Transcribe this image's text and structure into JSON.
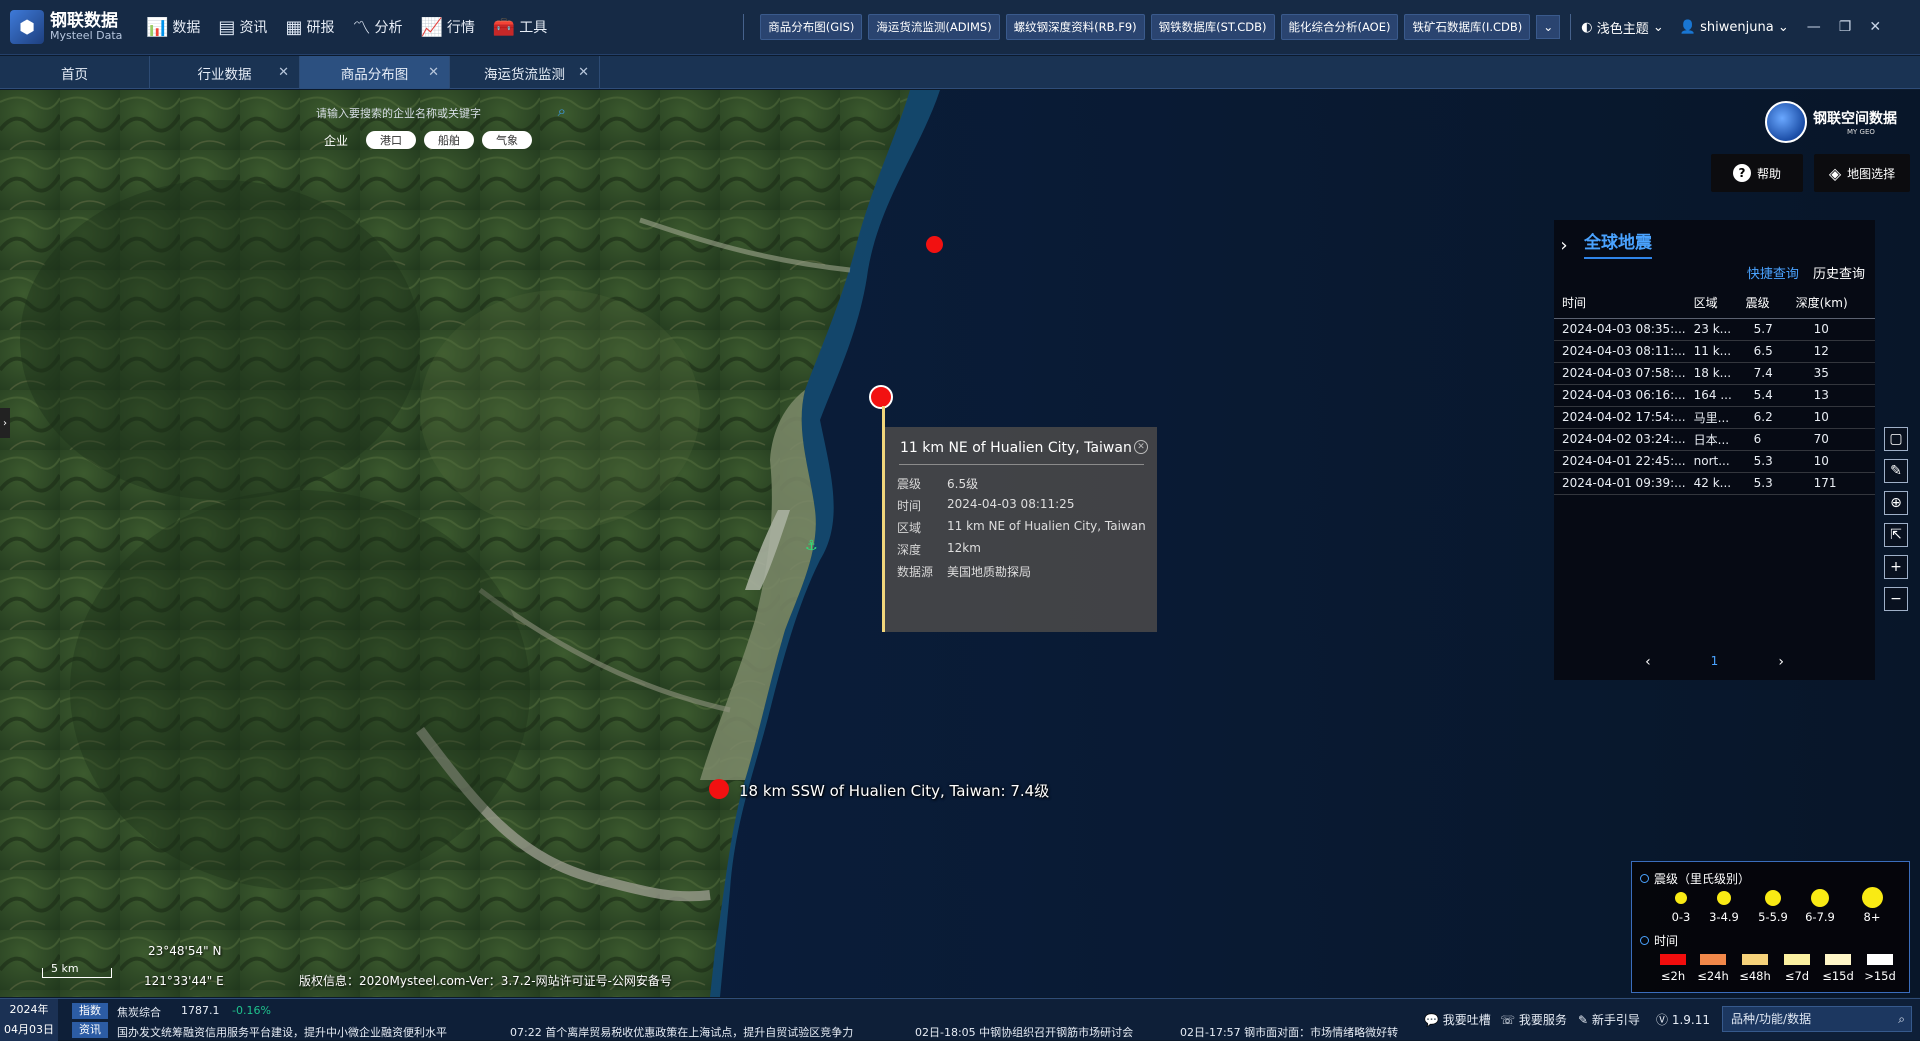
{
  "app": {
    "logo_cn": "钢联数据",
    "logo_en": "Mysteel Data"
  },
  "nav": [
    {
      "icon": "bar-chart-icon",
      "glyph": "📊",
      "label": "数据"
    },
    {
      "icon": "news-icon",
      "glyph": "▤",
      "label": "资讯"
    },
    {
      "icon": "report-icon",
      "glyph": "▦",
      "label": "研报"
    },
    {
      "icon": "analysis-icon",
      "glyph": "〽",
      "label": "分析"
    },
    {
      "icon": "market-icon",
      "glyph": "📈",
      "label": "行情"
    },
    {
      "icon": "toolbox-icon",
      "glyph": "🧰",
      "label": "工具"
    }
  ],
  "db_tabs": [
    "商品分布图(GIS)",
    "海运货流监测(ADIMS)",
    "螺纹钢深度资料(RB.F9)",
    "钢铁数据库(ST.CDB)",
    "能化综合分析(AOE)",
    "铁矿石数据库(I.CDB)"
  ],
  "right_nav": {
    "theme": "浅色主题",
    "user": "shiwenjuna"
  },
  "tabs": [
    {
      "label": "首页",
      "closable": false,
      "active": false
    },
    {
      "label": "行业数据",
      "closable": true,
      "active": false
    },
    {
      "label": "商品分布图",
      "closable": true,
      "active": true
    },
    {
      "label": "海运货流监测",
      "closable": true,
      "active": false
    }
  ],
  "search": {
    "placeholder": "请输入要搜索的企业名称或关键字"
  },
  "filters": {
    "label": "企业",
    "chips": [
      "港口",
      "船舶",
      "气象"
    ]
  },
  "brand": {
    "cn": "钢联空间数据",
    "en": "MY GEO"
  },
  "buttons": {
    "help": "帮助",
    "layers": "地图选择"
  },
  "quake_panel": {
    "title": "全球地震",
    "link_quick": "快捷查询",
    "link_history": "历史查询",
    "headers": [
      "时间",
      "区域",
      "震级",
      "深度(km)"
    ],
    "rows": [
      [
        "2024-04-03 08:35:...",
        "23 k...",
        "5.7",
        "10"
      ],
      [
        "2024-04-03 08:11:...",
        "11 k...",
        "6.5",
        "12"
      ],
      [
        "2024-04-03 07:58:...",
        "18 k...",
        "7.4",
        "35"
      ],
      [
        "2024-04-03 06:16:...",
        "164 ...",
        "5.4",
        "13"
      ],
      [
        "2024-04-02 17:54:...",
        "马里...",
        "6.2",
        "10"
      ],
      [
        "2024-04-02 03:24:...",
        "日本...",
        "6",
        "70"
      ],
      [
        "2024-04-01 22:45:...",
        "nort...",
        "5.3",
        "10"
      ],
      [
        "2024-04-01 09:39:...",
        "42 k...",
        "5.3",
        "171"
      ]
    ],
    "page_prev": "‹",
    "page_current": "1",
    "page_next": "›"
  },
  "popup": {
    "title": "11 km NE of Hualien City, Taiwan",
    "fields": [
      {
        "k": "震级",
        "v": "6.5级"
      },
      {
        "k": "时间",
        "v": "2024-04-03 08:11:25"
      },
      {
        "k": "区域",
        "v": "11 km NE of Hualien City, Taiwan"
      },
      {
        "k": "深度",
        "v": "12km"
      },
      {
        "k": "数据源",
        "v": "美国地质勘探局"
      }
    ]
  },
  "quake_label": "18 km SSW of Hualien City, Taiwan: 7.4级",
  "map_info": {
    "scale": "5 km",
    "lat": "23°48'54\" N",
    "lon": "121°33'44\" E",
    "copyright": "版权信息：2020Mysteel.com-Ver：3.7.2-网站许可证号-公网安备号"
  },
  "legend": {
    "mag_title": "震级（里氏级别）",
    "mag_classes": [
      "0-3",
      "3-4.9",
      "5-5.9",
      "6-7.9",
      "8+"
    ],
    "time_title": "时间",
    "time_classes": [
      {
        "label": "≤2h",
        "color": "#f20d0d"
      },
      {
        "label": "≤24h",
        "color": "#f2884a"
      },
      {
        "label": "≤48h",
        "color": "#f6d27a"
      },
      {
        "label": "≤7d",
        "color": "#fbf0a0"
      },
      {
        "label": "≤15d",
        "color": "#fff6c8"
      },
      {
        "label": ">15d",
        "color": "#ffffff"
      }
    ]
  },
  "status": {
    "year": "2024年",
    "day": "04月03日",
    "tag_index": "指数",
    "tag_news": "资讯",
    "index_name": "焦炭综合",
    "index_value": "1787.1",
    "index_change": "-0.16%",
    "news1": "国办发文统筹融资信用服务平台建设，提升中小微企业融资便利水平",
    "news2": "07:22  首个离岸贸易税收优惠政策在上海试点，提升自贸试验区竞争力",
    "news3": "02日-18:05  中钢协组织召开钢筋市场研讨会",
    "news4": "02日-17:57  钢市面对面：市场情绪略微好转",
    "feedback": "我要吐槽",
    "service": "我要服务",
    "guide": "新手引导",
    "version": "1.9.11",
    "search_placeholder": "品种/功能/数据"
  }
}
